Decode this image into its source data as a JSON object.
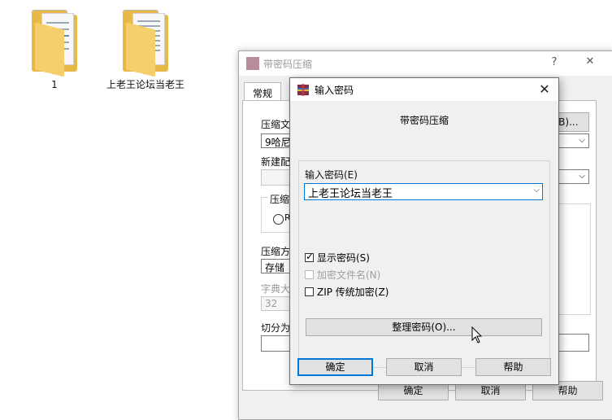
{
  "desktop": {
    "folders": [
      {
        "label": "1"
      },
      {
        "label": "上老王论坛当老王"
      }
    ]
  },
  "bg_dialog": {
    "title": "带密码压缩",
    "help_glyph": "?",
    "close_glyph": "✕",
    "tab_general": "常规",
    "label_archive": "压缩文",
    "archive_value": "9哈尼",
    "browse_label": "(B)...",
    "label_new_profile": "新建配",
    "label_format": "压缩文",
    "radio_label": "R",
    "label_method": "压缩方",
    "method_value": "存储",
    "label_dict": "字典大",
    "dict_value": "32",
    "label_split": "切分为",
    "ok_label": "确定",
    "cancel_label": "取消",
    "help_label": "帮助"
  },
  "pw_dialog": {
    "title": "输入密码",
    "close_glyph": "✕",
    "subtitle": "带密码压缩",
    "password_label": "输入密码(E)",
    "password_value": "上老王论坛当老王",
    "checkboxes": [
      {
        "label": "显示密码(S)",
        "checked": true,
        "enabled": true
      },
      {
        "label": "加密文件名(N)",
        "checked": false,
        "enabled": false
      },
      {
        "label": "ZIP 传统加密(Z)",
        "checked": false,
        "enabled": true
      }
    ],
    "organize_label": "整理密码(O)...",
    "ok_label": "确定",
    "cancel_label": "取消",
    "help_label": "帮助"
  }
}
